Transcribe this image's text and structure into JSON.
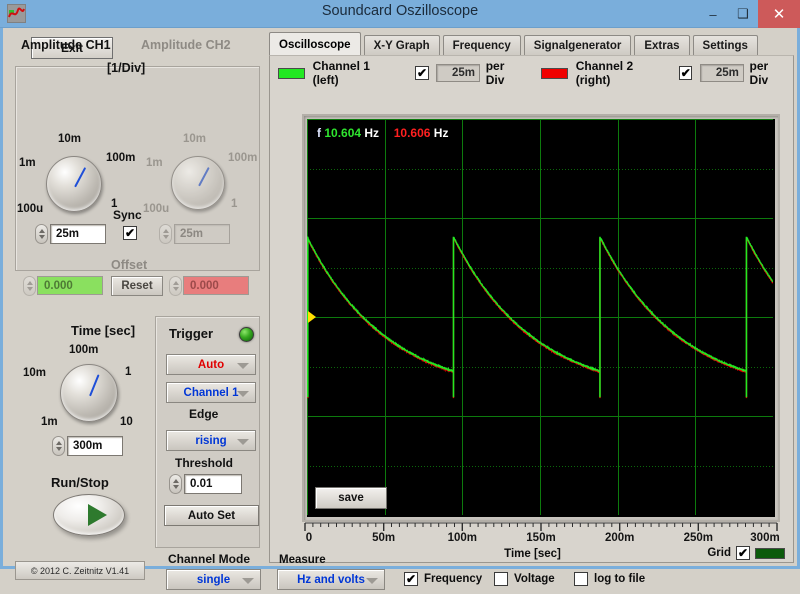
{
  "window": {
    "title": "Soundcard Oszilloscope",
    "app_icon": "waveform-icon",
    "minimize": "–",
    "maximize": "❑",
    "close": "✕"
  },
  "exit_button": {
    "label": "Exit"
  },
  "tabs": [
    {
      "label": "Oscilloscope",
      "active": true
    },
    {
      "label": "X-Y Graph",
      "active": false
    },
    {
      "label": "Frequency",
      "active": false
    },
    {
      "label": "Signalgenerator",
      "active": false
    },
    {
      "label": "Extras",
      "active": false
    },
    {
      "label": "Settings",
      "active": false
    }
  ],
  "channels": {
    "ch1": {
      "swatch_color": "#22e822",
      "label": "Channel 1 (left)",
      "enabled": true,
      "check_glyph": "✔",
      "value": "25m",
      "per_div": "per Div"
    },
    "ch2": {
      "swatch_color": "#f00000",
      "label": "Channel 2 (right)",
      "enabled": true,
      "check_glyph": "✔",
      "value": "25m",
      "per_div": "per Div"
    }
  },
  "scope": {
    "freq_prefix": "f",
    "ch1_freq": "10.604",
    "ch1_unit": "Hz",
    "ch2_freq": "10.606",
    "ch2_unit": "Hz",
    "save_label": "save",
    "trace1_color": "#22e822",
    "trace2_color": "#f00000",
    "grid_color": "#0d7a0d",
    "background": "#000000"
  },
  "chart_data": {
    "type": "line",
    "title": "",
    "xlabel": "Time [sec]",
    "ylabel": "",
    "xlim": [
      0,
      0.3
    ],
    "ylim": [
      -4,
      4
    ],
    "grid": true,
    "xticks": [
      "0",
      "50m",
      "100m",
      "150m",
      "200m",
      "250m",
      "300m"
    ],
    "xtick_values": [
      0,
      0.05,
      0.1,
      0.15,
      0.2,
      0.25,
      0.3
    ],
    "legend": [
      "Channel 1 (left)",
      "Channel 2 (right)"
    ],
    "annotations": [
      "f 10.604 Hz",
      "10.606 Hz"
    ],
    "series": [
      {
        "name": "Channel 1 (left)",
        "color": "#22e822",
        "period": 0.0943,
        "shape": "sawtooth-exponential-decay"
      },
      {
        "name": "Channel 2 (right)",
        "color": "#f00000",
        "period": 0.0943,
        "shape": "sawtooth-exponential-decay"
      }
    ],
    "trigger_marker": {
      "color": "#ffe000",
      "x": 0,
      "y": 0
    }
  },
  "xaxis": {
    "title": "Time [sec]",
    "ticks": [
      "0",
      "50m",
      "100m",
      "150m",
      "200m",
      "250m",
      "300m"
    ]
  },
  "grid_control": {
    "label": "Grid",
    "checked": true,
    "check_glyph": "✔",
    "swatch_color": "#0b5a0b"
  },
  "measure": {
    "title": "Measure",
    "mode": "Hz and volts",
    "options": [
      {
        "label": "Frequency",
        "checked": true,
        "check_glyph": "✔"
      },
      {
        "label": "Voltage",
        "checked": false,
        "check_glyph": ""
      },
      {
        "label": "log to file",
        "checked": false,
        "check_glyph": ""
      }
    ]
  },
  "amplitude": {
    "ch1_title": "Amplitude CH1",
    "ch2_title": "Amplitude CH2",
    "div_label": "[1/Div]",
    "knob_labels": [
      "1m",
      "10m",
      "100m",
      "1",
      "100u"
    ],
    "ch1_value": "25m",
    "ch2_value": "25m",
    "sync_label": "Sync",
    "sync_checked": true,
    "sync_glyph": "✔",
    "offset_label": "Offset",
    "offset_ch1": "0.000",
    "offset_ch2": "0.000",
    "reset_label": "Reset",
    "offset_ch1_color": "#8ae05f",
    "offset_ch2_color": "#e87d7d"
  },
  "time": {
    "title": "Time [sec]",
    "knob_labels": [
      "10m",
      "100m",
      "1",
      "10",
      "1m"
    ],
    "value": "300m",
    "runstop_label": "Run/Stop"
  },
  "trigger": {
    "title": "Trigger",
    "led_color": "#36a81f",
    "mode": "Auto",
    "source": "Channel 1",
    "edge_label": "Edge",
    "edge": "rising",
    "threshold_label": "Threshold",
    "threshold": "0.01",
    "autoset_label": "Auto Set"
  },
  "channel_mode": {
    "label": "Channel Mode",
    "value": "single"
  },
  "copyright": "© 2012  C. Zeitnitz V1.41"
}
